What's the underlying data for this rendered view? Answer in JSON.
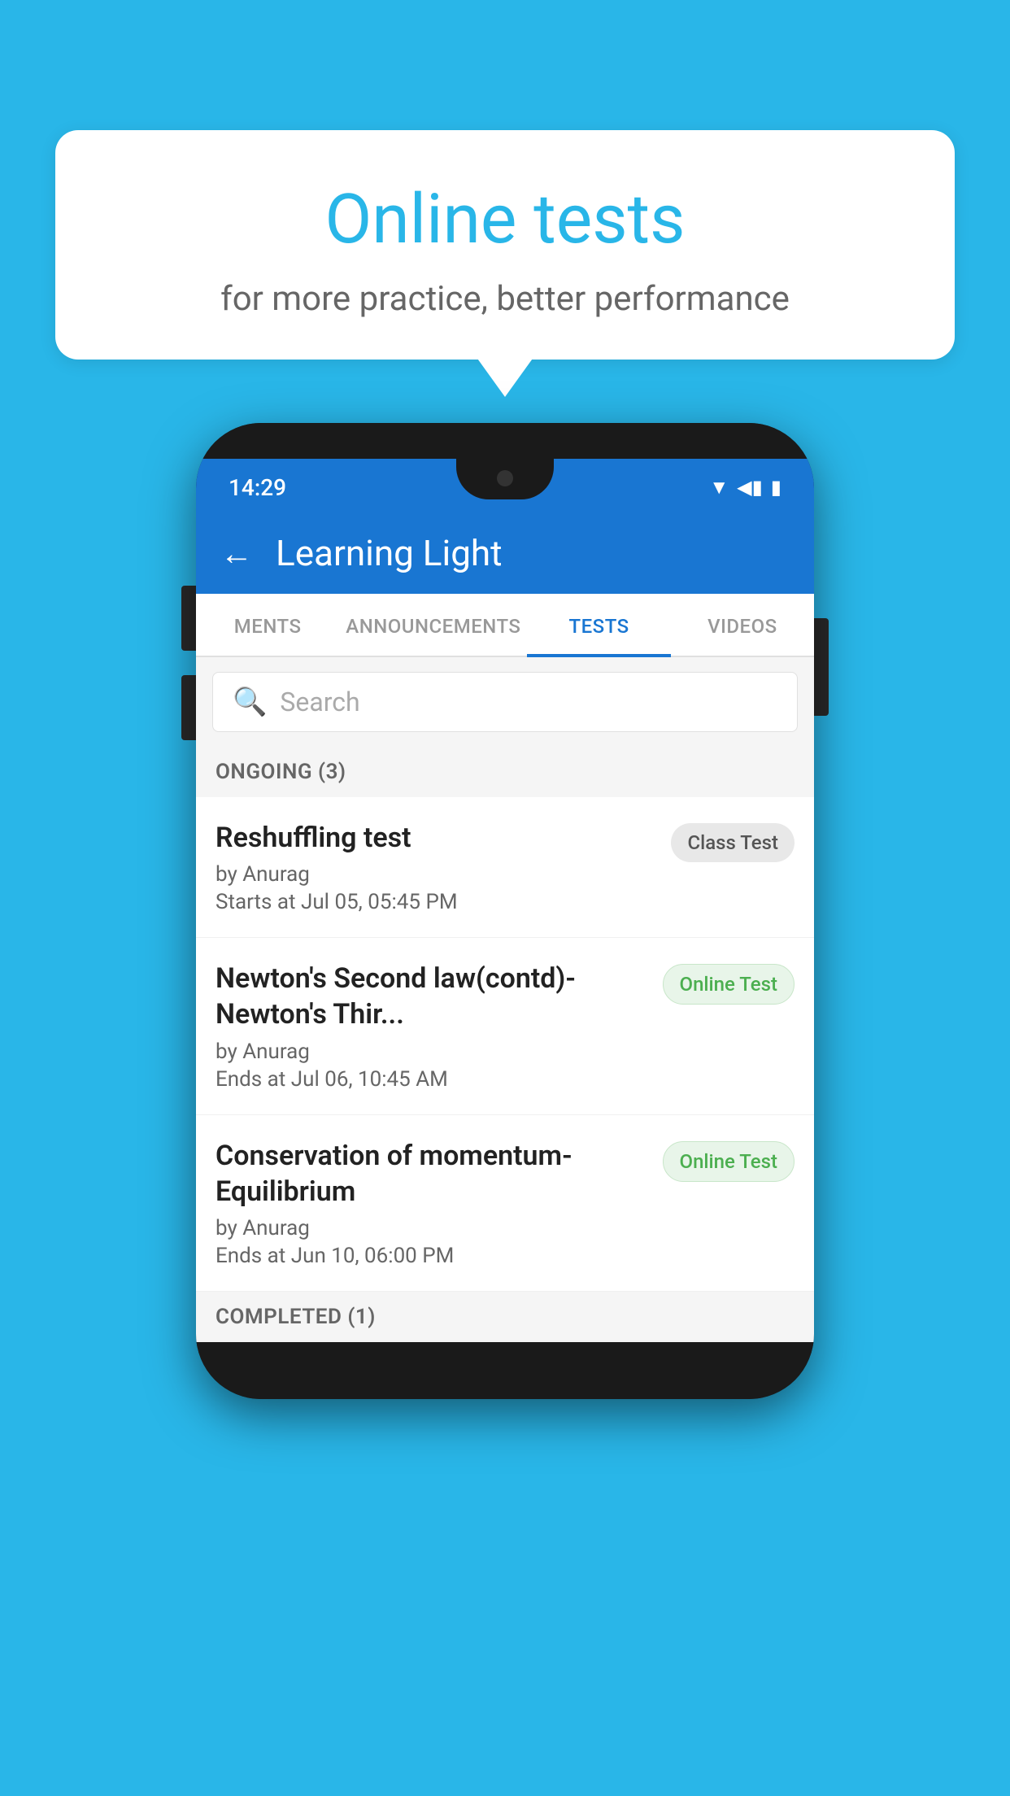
{
  "background": {
    "color": "#29b6e8"
  },
  "speech_bubble": {
    "title": "Online tests",
    "subtitle": "for more practice, better performance"
  },
  "phone": {
    "status_bar": {
      "time": "14:29",
      "icons": [
        "wifi",
        "signal",
        "battery"
      ]
    },
    "header": {
      "back_label": "←",
      "title": "Learning Light"
    },
    "tabs": [
      {
        "label": "MENTS",
        "active": false
      },
      {
        "label": "ANNOUNCEMENTS",
        "active": false
      },
      {
        "label": "TESTS",
        "active": true
      },
      {
        "label": "VIDEOS",
        "active": false
      }
    ],
    "search": {
      "placeholder": "Search"
    },
    "section_ongoing": {
      "label": "ONGOING (3)"
    },
    "tests": [
      {
        "title": "Reshuffling test",
        "by": "by Anurag",
        "date": "Starts at  Jul 05, 05:45 PM",
        "badge": "Class Test",
        "badge_type": "class"
      },
      {
        "title": "Newton's Second law(contd)-Newton's Thir...",
        "by": "by Anurag",
        "date": "Ends at  Jul 06, 10:45 AM",
        "badge": "Online Test",
        "badge_type": "online"
      },
      {
        "title": "Conservation of momentum-Equilibrium",
        "by": "by Anurag",
        "date": "Ends at  Jun 10, 06:00 PM",
        "badge": "Online Test",
        "badge_type": "online"
      }
    ],
    "section_completed": {
      "label": "COMPLETED (1)"
    }
  }
}
